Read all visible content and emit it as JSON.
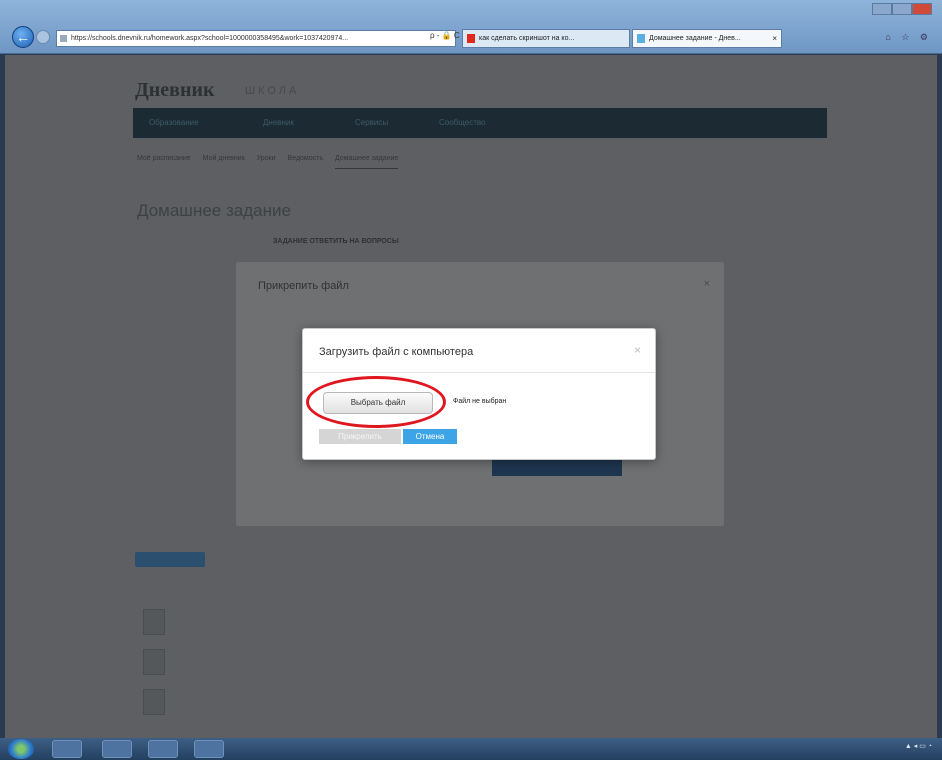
{
  "browser": {
    "url": "https://schools.dnevnik.ru/homework.aspx?school=1000000358495&work=1037420974...",
    "tabs": [
      {
        "label": "как сделать скриншот на ко..."
      },
      {
        "label": "Домашнее задание - Днев..."
      }
    ],
    "tab_close": "×",
    "addr_controls": "ρ - 🔒 C"
  },
  "page": {
    "logo": "Дневник",
    "logo_sub": "ШКОЛА",
    "nav": [
      "Образование",
      "Дневник",
      "Сервисы",
      "Сообщество"
    ],
    "subnav": [
      "Моё расписание",
      "Мой дневник",
      "Уроки",
      "Ведомость",
      "Домашнее задание"
    ],
    "title": "Домашнее задание",
    "hw_text": "ЗАДАНИЕ ОТВЕТИТЬ НА ВОПРОСЫ"
  },
  "outer_modal": {
    "title": "Прикрепить файл",
    "close": "×"
  },
  "dialog": {
    "title": "Загрузить файл с компьютера",
    "close": "×",
    "choose_file": "Выбрать файл",
    "no_file": "Файл не выбран",
    "attach": "Прикрепить",
    "cancel": "Отмена"
  },
  "colors": {
    "highlight_circle": "#e0161e",
    "cancel_button": "#3da4e8"
  }
}
